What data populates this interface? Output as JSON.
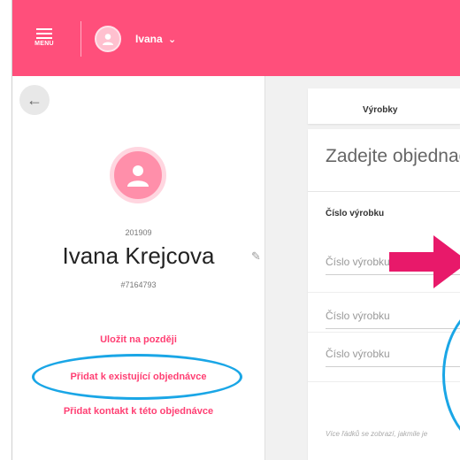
{
  "header": {
    "menu_label": "MENU",
    "user_name": "Ivana",
    "user_caret": "⌄",
    "accent_color": "#ff4f7b"
  },
  "left_panel": {
    "back_icon": "arrow-left-icon",
    "back_glyph": "←",
    "customer_id": "201909",
    "customer_name": "Ivana Krejcova",
    "customer_code": "#7164793",
    "edit_icon": "pencil-icon",
    "edit_glyph": "✎",
    "actions": [
      "Uložit na později",
      "Přidat k existující objednávce",
      "Přidat kontakt k této objednávce"
    ],
    "action_color": "#ff3f73"
  },
  "main": {
    "tab_label": "Výrobky",
    "form_heading": "Zadejte objednací",
    "column_header": "Číslo výrobku",
    "inputs": [
      {
        "placeholder": "Číslo výrobku"
      },
      {
        "placeholder": "Číslo výrobku"
      },
      {
        "placeholder": "Číslo výrobku"
      }
    ],
    "hint_text": "Více řádků se zobrazí, jakmile je"
  },
  "annotations": {
    "arrow_color": "#e8196a",
    "circle_color": "#1aa6e6"
  }
}
